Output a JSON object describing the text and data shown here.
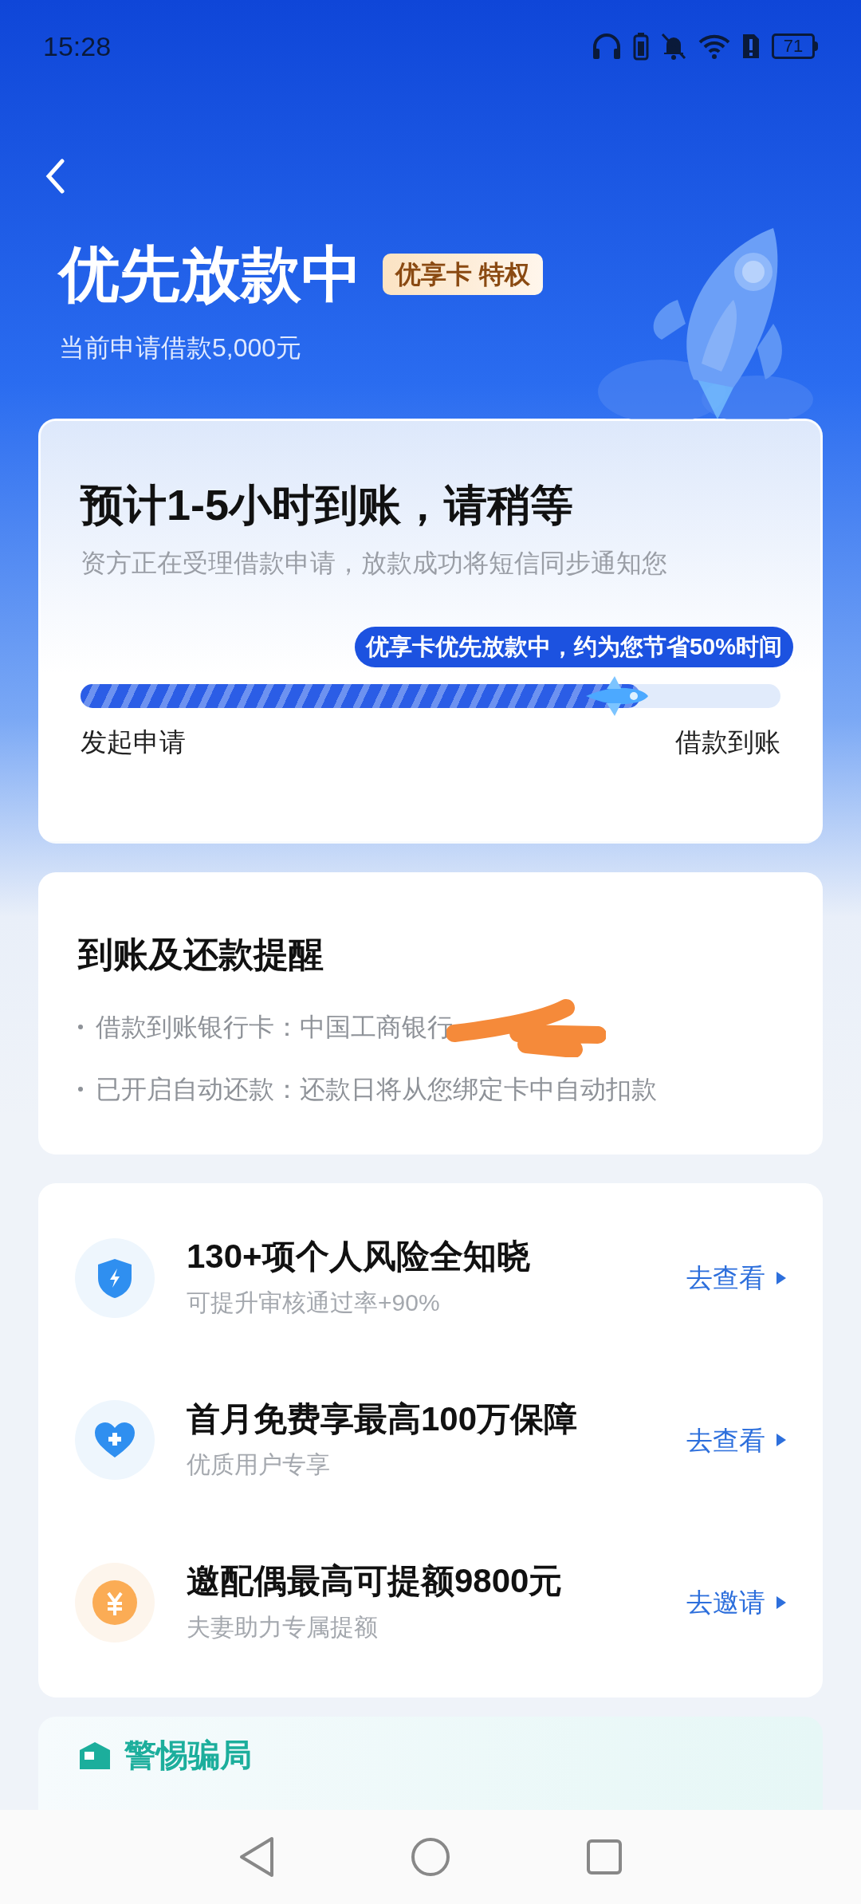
{
  "status_bar": {
    "time": "15:28",
    "battery": "71"
  },
  "header": {
    "title": "优先放款中",
    "badge": "优享卡 特权",
    "subtitle": "当前申请借款5,000元"
  },
  "progress_card": {
    "title": "预计1-5小时到账，请稍等",
    "description": "资方正在受理借款申请，放款成功将短信同步通知您",
    "tooltip": "优享卡优先放款中，约为您节省50%时间",
    "progress": {
      "level": 0.8
    },
    "start_label": "发起申请",
    "end_label": "借款到账"
  },
  "reminder_card": {
    "title": "到账及还款提醒",
    "items": [
      {
        "text": "借款到账银行卡：中国工商银行",
        "redacted": true
      },
      {
        "text": "已开启自动还款：还款日将从您绑定卡中自动扣款",
        "redacted": false
      }
    ]
  },
  "offers": [
    {
      "kind": "shield",
      "title": "130+项个人风险全知晓",
      "subtitle": "可提升审核通过率+90%",
      "action": "去查看"
    },
    {
      "kind": "heart",
      "title": "首月免费享最高100万保障",
      "subtitle": "优质用户专享",
      "action": "去查看"
    },
    {
      "kind": "coin",
      "title": "邀配偶最高可提额9800元",
      "subtitle": "夫妻助力专属提额",
      "action": "去邀请"
    }
  ],
  "scam_card": {
    "title": "警惕骗局"
  }
}
